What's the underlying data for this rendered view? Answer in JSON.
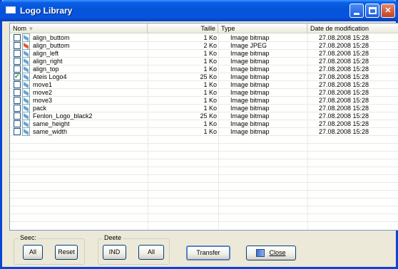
{
  "window": {
    "title": "Logo Library"
  },
  "columns": {
    "name": "Nom",
    "size": "Taille",
    "type": "Type",
    "date": "Date de modification"
  },
  "rows": [
    {
      "checked": false,
      "icon": "bitmap-file-icon",
      "name": "align_buttom",
      "size": "1 Ko",
      "type": "Image bitmap",
      "date": "27.08.2008 15:28"
    },
    {
      "checked": false,
      "icon": "jpeg-file-icon",
      "name": "align_buttom",
      "size": "2 Ko",
      "type": "Image JPEG",
      "date": "27.08.2008 15:28"
    },
    {
      "checked": false,
      "icon": "bitmap-file-icon",
      "name": "align_left",
      "size": "1 Ko",
      "type": "Image bitmap",
      "date": "27.08.2008 15:28"
    },
    {
      "checked": false,
      "icon": "bitmap-file-icon",
      "name": "align_right",
      "size": "1 Ko",
      "type": "Image bitmap",
      "date": "27.08.2008 15:28"
    },
    {
      "checked": false,
      "icon": "bitmap-file-icon",
      "name": "align_top",
      "size": "1 Ko",
      "type": "Image bitmap",
      "date": "27.08.2008 15:28"
    },
    {
      "checked": true,
      "icon": "bitmap-file-icon",
      "name": "Ateis Logo4",
      "size": "25 Ko",
      "type": "Image bitmap",
      "date": "27.08.2008 15:28"
    },
    {
      "checked": false,
      "icon": "bitmap-file-icon",
      "name": "move1",
      "size": "1 Ko",
      "type": "Image bitmap",
      "date": "27.08.2008 15:28"
    },
    {
      "checked": false,
      "icon": "bitmap-file-icon",
      "name": "move2",
      "size": "1 Ko",
      "type": "Image bitmap",
      "date": "27.08.2008 15:28"
    },
    {
      "checked": false,
      "icon": "bitmap-file-icon",
      "name": "move3",
      "size": "1 Ko",
      "type": "Image bitmap",
      "date": "27.08.2008 15:28"
    },
    {
      "checked": false,
      "icon": "bitmap-file-icon",
      "name": "pack",
      "size": "1 Ko",
      "type": "Image bitmap",
      "date": "27.08.2008 15:28"
    },
    {
      "checked": false,
      "icon": "bitmap-file-icon",
      "name": "Fenlon_Logo_black2",
      "size": "25 Ko",
      "type": "Image bitmap",
      "date": "27.08.2008 15:28"
    },
    {
      "checked": false,
      "icon": "bitmap-file-icon",
      "name": "same_height",
      "size": "1 Ko",
      "type": "Image bitmap",
      "date": "27.08.2008 15:28"
    },
    {
      "checked": false,
      "icon": "bitmap-file-icon",
      "name": "same_width",
      "size": "1 Ko",
      "type": "Image bitmap",
      "date": "27.08.2008 15:28"
    }
  ],
  "select_group": {
    "label": "Seec:",
    "all": "All",
    "reset": "Reset"
  },
  "delete_group": {
    "label": "Deete",
    "ind": "IND",
    "all": "All"
  },
  "buttons": {
    "transfer": "Transfer",
    "close": "Close"
  },
  "colors": {
    "title_bar": "#0553d6",
    "window_bg": "#ece9d8",
    "close_button": "#c2401f"
  }
}
